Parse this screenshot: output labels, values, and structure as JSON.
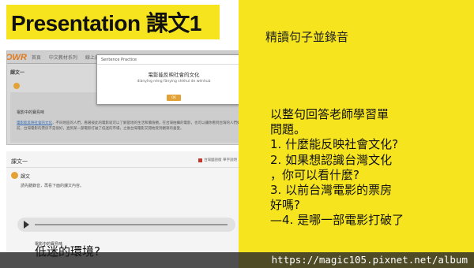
{
  "title": "Presentation 課文1",
  "top_note": "精讀句子並錄音",
  "questions": [
    "以整句回答老師學習單",
    "問題。",
    "1. 什麼能反映社會文化?",
    "2. 如果想認識台灣文化",
    "，你可以看什麼?",
    "3. 以前台灣電影的票房",
    "好嗎?",
    "—4. 是哪一部電影打破了",
    "低迷的環境?"
  ],
  "shot1": {
    "logo": "OWR",
    "nav": [
      "首頁",
      "中文教材系列",
      "線上自修課程"
    ],
    "lesson": "課文一",
    "subhead": "電影中的寶島味",
    "paragraph_link": "電影能反映社會的文化",
    "paragraph": "，不同地區的人們，看著彼此的電影就可以了解當地的生活和價值觀。在台灣拍攝的電影，也可以讓你看到台灣的人們如何看待自己的故事。以前，台灣電影的票房不是很好，直到某一部電影打破了低迷的市場，之後台灣電影又開始受到觀眾的喜愛。",
    "modal": {
      "header": "Sentence Practice",
      "close": "×",
      "sentence": "電影能反映社會的文化",
      "pinyin": "diànyǐng néng fǎnyìng shèhuì de wénhuà",
      "button": "OK"
    }
  },
  "shot2": {
    "header": "課文一",
    "tag": "台灣國語版 單字說明",
    "lesson": "課文",
    "instruction": "請先聽錄音，再看下面的課文內容。",
    "subhead": "電影中的寶島味"
  },
  "watermark": "https://magic105.pixnet.net/album",
  "colors": {
    "yellow": "#f6e51e",
    "orange": "#e3a236",
    "link": "#3b6fb6"
  }
}
